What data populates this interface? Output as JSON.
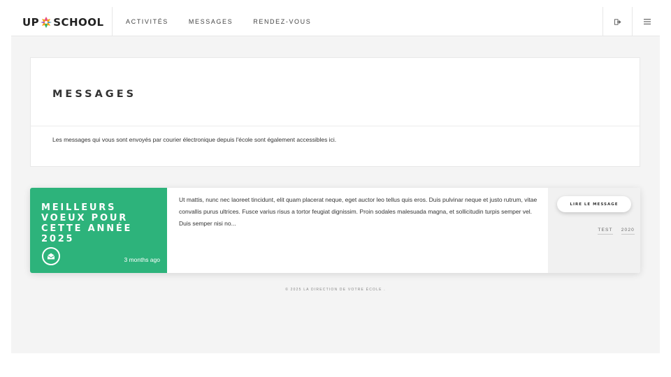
{
  "header": {
    "logo": {
      "left": "UP",
      "right": "SCHOOL"
    },
    "nav": [
      "ACTIVITÉS",
      "MESSAGES",
      "RENDEZ-VOUS"
    ],
    "icons": {
      "logout": "logout-icon",
      "menu": "menu-icon"
    }
  },
  "page": {
    "title": "MESSAGES",
    "description": "Les messages qui vous sont envoyés par courier électronique depuis l'école sont également accessibles ici."
  },
  "messages": [
    {
      "title": "MEILLEURS VOEUX POUR CETTE ANNÉE 2025",
      "time": "3 months ago",
      "excerpt": "Ut mattis, nunc nec laoreet tincidunt, elit quam placerat neque, eget auctor leo tellus quis eros. Duis pulvinar neque et justo rutrum, vitae convallis purus ultrices. Fusce varius risus a tortor feugiat dignissim. Proin sodales malesuada magna, et sollicitudin turpis semper vel. Duis semper nisi no...",
      "read_label": "LIRE LE MESSAGE",
      "tags": [
        "TEST",
        "2020"
      ]
    }
  ],
  "footer": {
    "text": "© 2025 LA DIRECTION DE VOTRE ÉCOLE ."
  },
  "colors": {
    "accent": "#2db37b",
    "background": "#f4f4f4"
  }
}
